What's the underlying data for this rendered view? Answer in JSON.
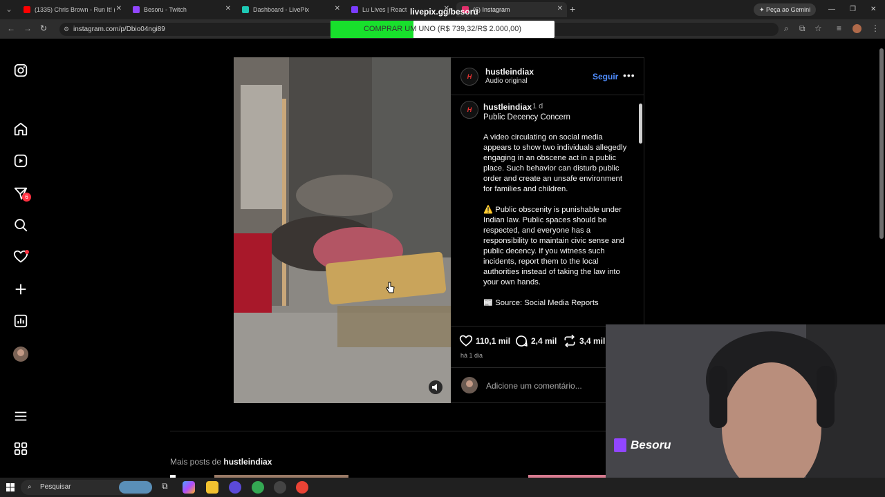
{
  "browser": {
    "tabs": [
      {
        "label": "(1335) Chris Brown - Run It! (Of",
        "color": "#ff0000"
      },
      {
        "label": "Besoru - Twitch",
        "color": "#9146ff"
      },
      {
        "label": "Dashboard - LivePix",
        "color": "#1ec8b4"
      },
      {
        "label": "Lu Lives | React",
        "color": "#7a3cff"
      },
      {
        "label": "(6) Instagram",
        "color": "#e1306c"
      }
    ],
    "url": "instagram.com/p/Dbio04ngi89",
    "gemini_label": "Peça ao Gemini"
  },
  "overlay": {
    "livepix_url": "livepix.gg/besoru",
    "donation_text": "COMPRAR UM UNO (R$ 739,32/R$ 2.000,00)",
    "donation_progress": 0.3697
  },
  "sidebar": {
    "items": [
      {
        "icon": "instagram-logo-icon"
      },
      {
        "icon": "home-icon"
      },
      {
        "icon": "reels-icon"
      },
      {
        "icon": "messages-icon"
      },
      {
        "icon": "search-icon"
      },
      {
        "icon": "notifications-icon"
      },
      {
        "icon": "create-icon"
      },
      {
        "icon": "dashboard-icon"
      },
      {
        "icon": "profile-avatar-icon"
      },
      {
        "icon": "menu-icon"
      },
      {
        "icon": "more-apps-icon"
      }
    ],
    "messages_badge": "6"
  },
  "post": {
    "username": "hustleindiax",
    "audio": "Áudio original",
    "follow_label": "Seguir",
    "avatar_text": "H",
    "caption": {
      "username": "hustleindiax",
      "time": "1 d",
      "title": "Public Decency Concern",
      "paragraphs": [
        "A video circulating on social media appears to show two individuals allegedly engaging in an obscene act in a public place. Such behavior can disturb public order and create an unsafe environment for families and children.",
        "⚠️ Public obscenity is punishable under Indian law. Public spaces should be respected, and everyone has a responsibility to maintain civic sense and public decency. If you witness such incidents, report them to the local authorities instead of taking the law into your own hands.",
        "📰 Source: Social Media Reports"
      ]
    },
    "likes": "110,1 mil",
    "comments": "2,4 mil",
    "shares": "3,4 mil",
    "posted_ago": "há 1 dia",
    "comment_placeholder": "Adicione um comentário..."
  },
  "more_posts": {
    "prefix": "Mais posts de ",
    "username": "hustleindiax"
  },
  "webcam": {
    "channel": "Besoru"
  },
  "taskbar": {
    "search_label": "Pesquisar"
  }
}
